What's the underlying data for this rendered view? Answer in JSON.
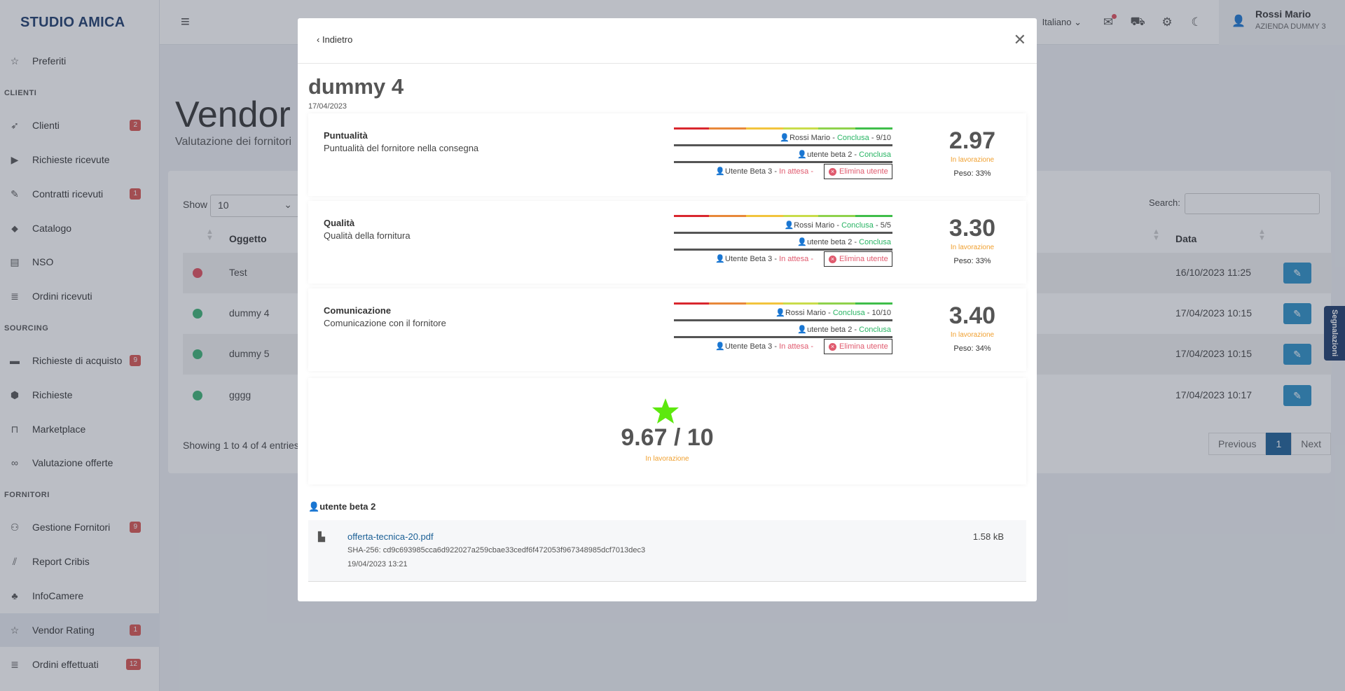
{
  "app": {
    "logo": "STUDIO AMICA"
  },
  "sidebar": {
    "items": [
      {
        "label": "Preferiti",
        "icon": "star-icon"
      },
      {
        "label": "Clienti",
        "icon": "rocket-icon",
        "badge": "2"
      },
      {
        "label": "Richieste ricevute",
        "icon": "play-circle-icon"
      },
      {
        "label": "Contratti ricevuti",
        "icon": "file-signature-icon",
        "badge": "1"
      },
      {
        "label": "Catalogo",
        "icon": "tags-icon"
      },
      {
        "label": "NSO",
        "icon": "list-box-icon"
      },
      {
        "label": "Ordini ricevuti",
        "icon": "receipt-icon"
      },
      {
        "label": "Richieste di acquisto",
        "icon": "card-icon",
        "badge": "9"
      },
      {
        "label": "Richieste",
        "icon": "cube-icon"
      },
      {
        "label": "Marketplace",
        "icon": "bag-icon"
      },
      {
        "label": "Valutazione offerte",
        "icon": "glasses-icon"
      },
      {
        "label": "Gestione Fornitori",
        "icon": "users-icon",
        "badge": "9"
      },
      {
        "label": "Report Cribis",
        "icon": "cribis-icon"
      },
      {
        "label": "InfoCamere",
        "icon": "tree-icon"
      },
      {
        "label": "Vendor Rating",
        "icon": "star-icon",
        "badge": "1"
      },
      {
        "label": "Ordini effettuati",
        "icon": "receipt-icon",
        "badge": "12"
      }
    ],
    "sections": {
      "clienti": "CLIENTI",
      "sourcing": "SOURCING",
      "fornitori": "FORNITORI"
    }
  },
  "topbar": {
    "language": "Italiano",
    "user_name": "Rossi Mario",
    "user_company": "AZIENDA DUMMY 3"
  },
  "page": {
    "title": "Vendor",
    "subtitle": "Valutazione dei fornitori",
    "show_label": "Show",
    "show_value": "10",
    "search_label": "Search:",
    "columns": {
      "oggetto": "Oggetto",
      "data": "Data"
    },
    "rows": [
      {
        "status_color": "#e04e5b",
        "oggetto": "Test",
        "data": "16/10/2023 11:25"
      },
      {
        "status_color": "#3bb273",
        "oggetto": "dummy 4",
        "data": "17/04/2023 10:15"
      },
      {
        "status_color": "#3bb273",
        "oggetto": "dummy 5",
        "data": "17/04/2023 10:15"
      },
      {
        "status_color": "#3bb273",
        "oggetto": "gggg",
        "data": "17/04/2023 10:17"
      }
    ],
    "showing": "Showing 1 to 4 of 4 entries",
    "pager": {
      "previous": "Previous",
      "current": "1",
      "next": "Next"
    },
    "segnalazioni": "Segnalazioni"
  },
  "modal": {
    "back": "Indietro",
    "title": "dummy 4",
    "date": "17/04/2023",
    "criteria": [
      {
        "name": "Puntualità",
        "description": "Puntualità del fornitore nella consegna",
        "evaluations": [
          {
            "user": "Rossi Mario",
            "status": "Conclusa",
            "vote": "9/10"
          },
          {
            "user": "utente beta 2",
            "status": "Conclusa",
            "vote": ""
          },
          {
            "user": "Utente Beta 3",
            "status": "In attesa",
            "action": "Elimina utente"
          }
        ],
        "score": "2.97",
        "state": "In lavorazione",
        "weight": "Peso: 33%"
      },
      {
        "name": "Qualità",
        "description": "Qualità della fornitura",
        "evaluations": [
          {
            "user": "Rossi Mario",
            "status": "Conclusa",
            "vote": "5/5"
          },
          {
            "user": "utente beta 2",
            "status": "Conclusa",
            "vote": ""
          },
          {
            "user": "Utente Beta 3",
            "status": "In attesa",
            "action": "Elimina utente"
          }
        ],
        "score": "3.30",
        "state": "In lavorazione",
        "weight": "Peso: 33%"
      },
      {
        "name": "Comunicazione",
        "description": "Comunicazione con il fornitore",
        "evaluations": [
          {
            "user": "Rossi Mario",
            "status": "Conclusa",
            "vote": "10/10"
          },
          {
            "user": "utente beta 2",
            "status": "Conclusa",
            "vote": ""
          },
          {
            "user": "Utente Beta 3",
            "status": "In attesa",
            "action": "Elimina utente"
          }
        ],
        "score": "3.40",
        "state": "In lavorazione",
        "weight": "Peso: 34%"
      }
    ],
    "total": {
      "value": "9.67 / 10",
      "state": "In lavorazione",
      "star_color": "#5de80e"
    },
    "attachment": {
      "user": "utente beta 2",
      "filename": "offerta-tecnica-20.pdf",
      "sha": "SHA-256: cd9c693985cca6d922027a259cbae33cedf6f472053f967348985dcf7013dec3",
      "date": "19/04/2023 13:21",
      "size": "1.58 kB"
    }
  }
}
